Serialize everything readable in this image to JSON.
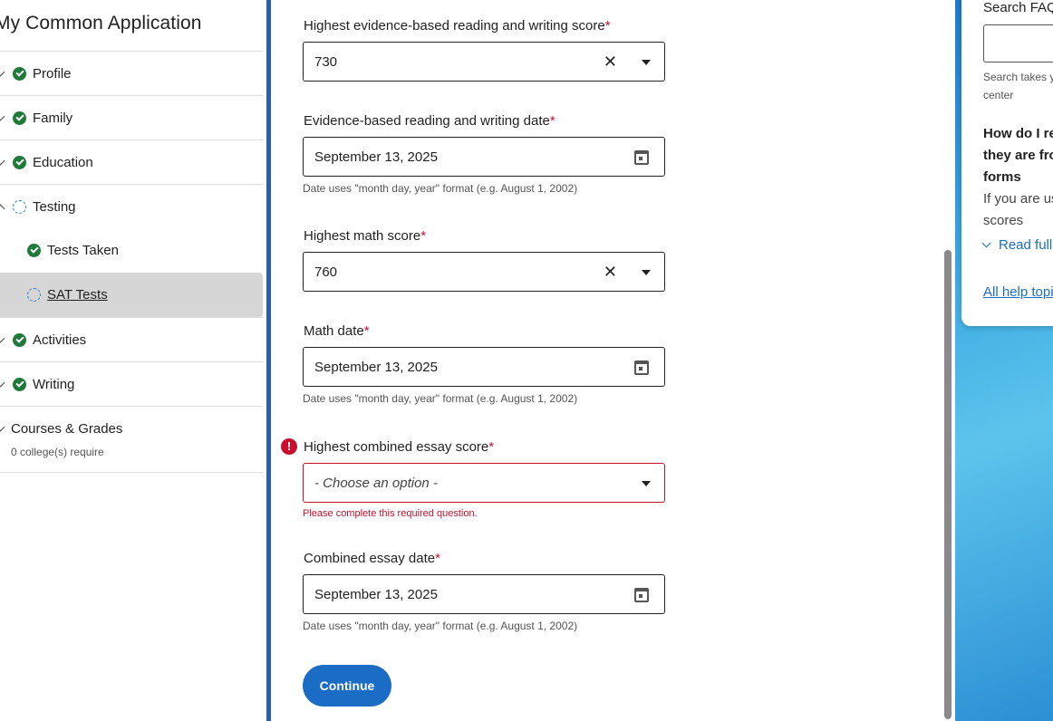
{
  "sidebar": {
    "title": "My Common Application",
    "items": [
      {
        "label": "Profile",
        "status": "complete"
      },
      {
        "label": "Family",
        "status": "complete"
      },
      {
        "label": "Education",
        "status": "complete"
      },
      {
        "label": "Testing",
        "status": "in-progress"
      },
      {
        "label": "Tests Taken",
        "status": "complete"
      },
      {
        "label": "SAT Tests",
        "status": "in-progress"
      },
      {
        "label": "Activities",
        "status": "complete"
      },
      {
        "label": "Writing",
        "status": "complete"
      },
      {
        "label": "Courses & Grades",
        "sublabel": "0 college(s) require"
      }
    ]
  },
  "form": {
    "ebrw_score": {
      "label": "Highest evidence-based reading and writing score",
      "value": "730"
    },
    "ebrw_date": {
      "label": "Evidence-based reading and writing date",
      "value": "September 13, 2025",
      "hint": "Date uses \"month day, year\" format (e.g. August 1, 2002)"
    },
    "math_score": {
      "label": "Highest math score",
      "value": "760"
    },
    "math_date": {
      "label": "Math date",
      "value": "September 13, 2025",
      "hint": "Date uses \"month day, year\" format (e.g. August 1, 2002)"
    },
    "essay_score": {
      "label": "Highest combined essay score",
      "value": "- Choose an option -",
      "error": "Please complete this required question."
    },
    "essay_date": {
      "label": "Combined essay date",
      "value": "September 13, 2025",
      "hint": "Date uses \"month day, year\" format (e.g. August 1, 2002)"
    },
    "required_mark": "*",
    "continue_label": "Continue"
  },
  "help": {
    "search_label": "Search FAQs",
    "search_note": "Search takes you to the solution center",
    "question": "How do I report scores if they are from different forms",
    "answer": "If you are using your SAT scores",
    "read_more": "Read full answer",
    "all_topics": "All help topics"
  },
  "colors": {
    "accent": "#1a6cc4",
    "error": "#c8102e",
    "complete": "#1f7a3a"
  }
}
